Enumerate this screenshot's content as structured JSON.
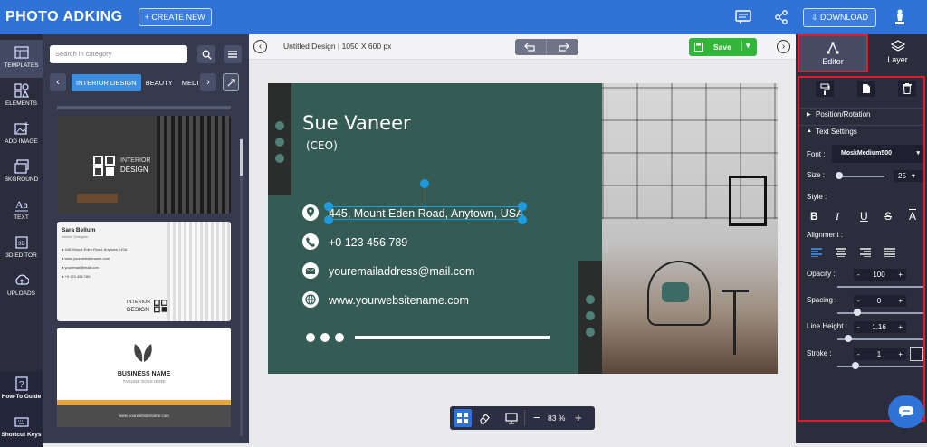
{
  "app": {
    "logo": "PHOTO ADKING",
    "create_new": "+ CREATE NEW",
    "download": "DOWNLOAD"
  },
  "nav": [
    {
      "label": "TEMPLATES",
      "icon": "templates-icon"
    },
    {
      "label": "ELEMENTS",
      "icon": "elements-icon"
    },
    {
      "label": "ADD IMAGE",
      "icon": "add-image-icon"
    },
    {
      "label": "BKGROUND",
      "icon": "background-icon"
    },
    {
      "label": "TEXT",
      "icon": "text-icon"
    },
    {
      "label": "3D EDITOR",
      "icon": "3d-editor-icon"
    },
    {
      "label": "UPLOADS",
      "icon": "upload-icon"
    },
    {
      "label": "How-To Guide",
      "icon": "guide-icon"
    },
    {
      "label": "Shortcut Keys",
      "icon": "keyboard-icon"
    }
  ],
  "search": {
    "placeholder": "Search in category"
  },
  "categories": [
    "INTERIOR DESIGN",
    "BEAUTY",
    "MEDI"
  ],
  "templates": {
    "t1": {
      "line1": "INTERIOR",
      "line2": "DESIGN"
    },
    "t2": {
      "name": "Sara Bellum",
      "role": "Interior Designer",
      "lines": [
        "445, Mount Eden Road, Anytown, USA",
        "www.yourwebsitename.com",
        "youremail@mail.com",
        "+0 123 456 789"
      ],
      "line1": "INTERIOR",
      "line2": "DESIGN"
    },
    "t3": {
      "title": "BUSINESS NAME",
      "tagline": "TAGLINE GOES HERE",
      "url": "www.yourwebsitename.com"
    }
  },
  "canvas": {
    "doc_title": "Untitled Design | 1050 X 600 px",
    "save": "Save",
    "zoom": "83 %"
  },
  "card": {
    "name": "Sue Vaneer",
    "role": "(CEO)",
    "address": "445, Mount Eden Road, Anytown, USA",
    "phone": "+0 123 456 789",
    "email": "youremailaddress@mail.com",
    "website": "www.yourwebsitename.com",
    "bg_color": "#355b55"
  },
  "panel": {
    "tabs": [
      "Editor",
      "Layer"
    ],
    "sections": [
      "Position/Rotation",
      "Text Settings"
    ],
    "font_label": "Font :",
    "font_value": "MoskMedium500",
    "size_label": "Size :",
    "size_value": "25",
    "style_label": "Style :",
    "style_buttons": [
      "B",
      "I",
      "U",
      "S",
      "A"
    ],
    "alignment_label": "Alignment :",
    "opacity_label": "Opacity :",
    "opacity_value": "100",
    "opacity_level": 1.0,
    "spacing_label": "Spacing :",
    "spacing_value": "0",
    "lineheight_label": "Line Height :",
    "lineheight_value": "1.16",
    "stroke_label": "Stroke :",
    "stroke_value": "1",
    "stepper_minus": "-",
    "stepper_plus": "+"
  },
  "colors": {
    "accent": "#2f73d8",
    "save": "#33b53a",
    "highlight": "#e21b2b",
    "selection": "#1e9bde"
  }
}
